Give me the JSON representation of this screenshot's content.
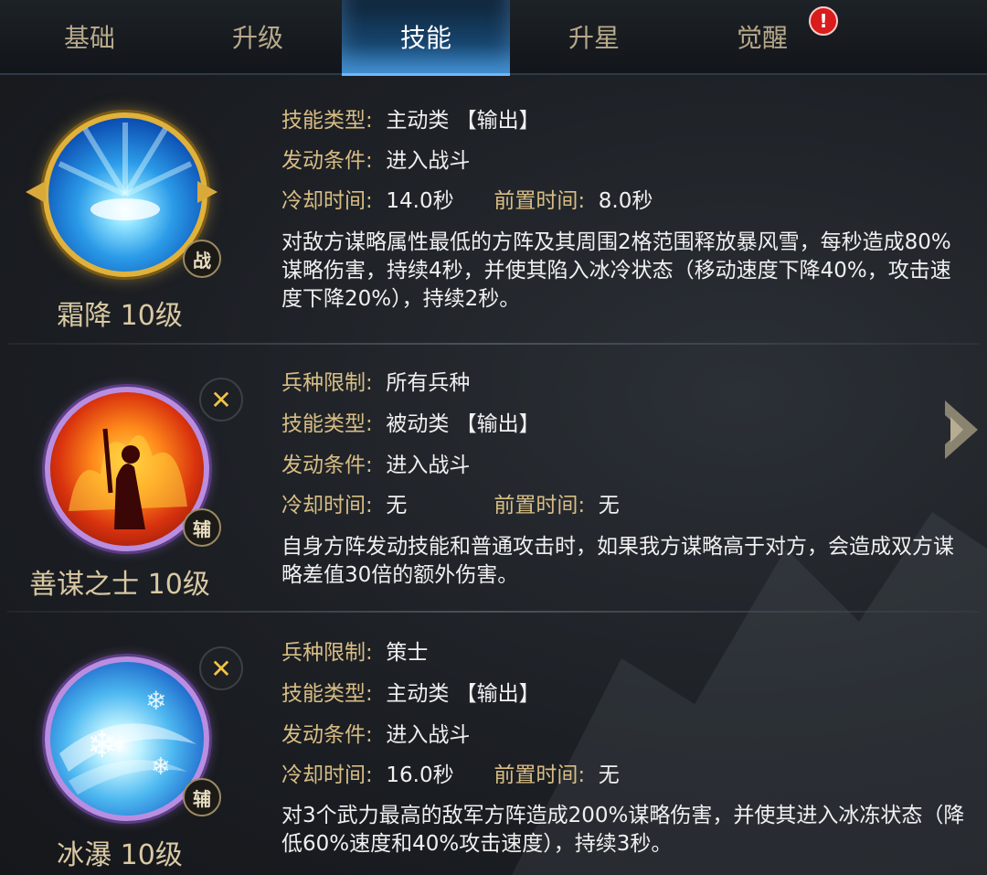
{
  "tabs": [
    {
      "label": "基础"
    },
    {
      "label": "升级"
    },
    {
      "label": "技能"
    },
    {
      "label": "升星"
    },
    {
      "label": "觉醒"
    }
  ],
  "alert_badge": "!",
  "skills": [
    {
      "name": "霜降 10级",
      "role": "战",
      "icon": "frost-snowstorm-icon",
      "rows": [
        {
          "label": "技能类型:",
          "value": "主动类 【输出】"
        },
        {
          "label": "发动条件:",
          "value": "进入战斗"
        }
      ],
      "timing": {
        "cd_label": "冷却时间:",
        "cd_value": "14.0秒",
        "pre_label": "前置时间:",
        "pre_value": "8.0秒"
      },
      "description": "对敌方谋略属性最低的方阵及其周围2格范围释放暴风雪，每秒造成80%谋略伤害，持续4秒，并使其陷入冰冷状态（移动速度下降40%，攻击速度下降20%），持续2秒。"
    },
    {
      "name": "善谋之士 10级",
      "role": "辅",
      "icon": "fire-strategist-icon",
      "rows": [
        {
          "label": "兵种限制:",
          "value": "所有兵种"
        },
        {
          "label": "技能类型:",
          "value": "被动类 【输出】"
        },
        {
          "label": "发动条件:",
          "value": "进入战斗"
        }
      ],
      "timing": {
        "cd_label": "冷却时间:",
        "cd_value": "无",
        "pre_label": "前置时间:",
        "pre_value": "无"
      },
      "description": "自身方阵发动技能和普通攻击时，如果我方谋略高于对方，会造成双方谋略差值30倍的额外伤害。"
    },
    {
      "name": "冰瀑 10级",
      "role": "辅",
      "icon": "ice-waterfall-icon",
      "rows": [
        {
          "label": "兵种限制:",
          "value": "策士"
        },
        {
          "label": "技能类型:",
          "value": "主动类 【输出】"
        },
        {
          "label": "发动条件:",
          "value": "进入战斗"
        }
      ],
      "timing": {
        "cd_label": "冷却时间:",
        "cd_value": "16.0秒",
        "pre_label": "前置时间:",
        "pre_value": "无"
      },
      "description": "对3个武力最高的敌军方阵造成200%谋略伤害，并使其进入冰冻状态（降低60%速度和40%攻击速度），持续3秒。"
    }
  ],
  "colors": {
    "label": "#d8bd84",
    "value": "#f0f0f0",
    "skill_name": "#d9c9a3",
    "tab_active": "#2a78b8",
    "alert": "#d91c1c"
  }
}
